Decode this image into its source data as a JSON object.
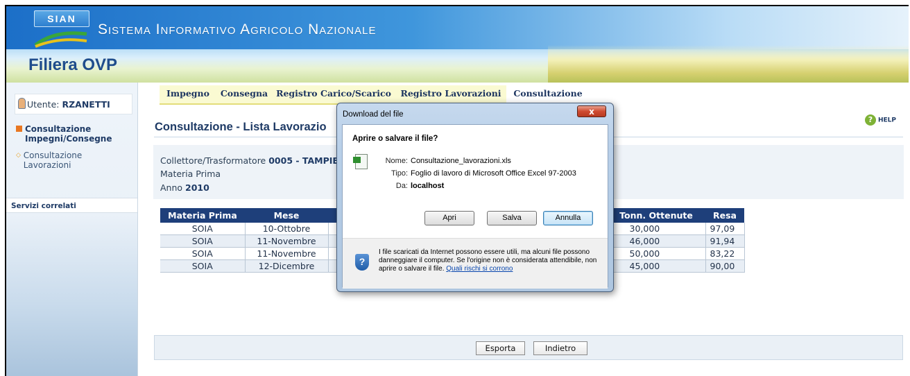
{
  "header": {
    "logo_text": "SIAN",
    "system_name": "Sistema Informativo Agricolo Nazionale",
    "app_name": "Filiera OVP"
  },
  "sidebar": {
    "user_label": "Utente:",
    "user_name": "RZANETTI",
    "items": [
      {
        "label": "Consultazione Impegni/Consegne"
      },
      {
        "label": "Consultazione Lavorazioni"
      }
    ],
    "related_label": "Servizi correlati"
  },
  "tabs": [
    {
      "label": "Impegno"
    },
    {
      "label": "Consegna"
    },
    {
      "label": "Registro Carico/Scarico"
    },
    {
      "label": "Registro Lavorazioni"
    },
    {
      "label": "Consultazione"
    }
  ],
  "help_label": "HELP",
  "page_title": "Consultazione - Lista Lavorazio",
  "info": {
    "collettore_label": "Collettore/Trasformatore",
    "collettore_value": "0005 - TAMPIE",
    "materia_label": "Materia Prima",
    "anno_label": "Anno",
    "anno_value": "2010"
  },
  "table": {
    "headers": {
      "materia": "Materia Prima",
      "mese": "Mese",
      "tonn": "Tonn. Ottenute",
      "resa": "Resa"
    },
    "rows": [
      {
        "materia": "SOIA",
        "mese": "10-Ottobre",
        "tonn": "30,000",
        "resa": "97,09"
      },
      {
        "materia": "SOIA",
        "mese": "11-Novembre",
        "tonn": "46,000",
        "resa": "91,94"
      },
      {
        "materia": "SOIA",
        "mese": "11-Novembre",
        "tonn": "50,000",
        "resa": "83,22"
      },
      {
        "materia": "SOIA",
        "mese": "12-Dicembre",
        "tonn": "45,000",
        "resa": "90,00"
      }
    ]
  },
  "buttons": {
    "esporta": "Esporta",
    "indietro": "Indietro"
  },
  "dialog": {
    "title": "Download del file",
    "close_label": "x",
    "question": "Aprire o salvare il file?",
    "nome_label": "Nome:",
    "nome_value": "Consultazione_lavorazioni.xls",
    "tipo_label": "Tipo:",
    "tipo_value": "Foglio di lavoro di Microsoft Office Excel 97-2003",
    "da_label": "Da:",
    "da_value": "localhost",
    "apri_label": "Apri",
    "salva_label": "Salva",
    "annulla_label": "Annulla",
    "warning_text": "I file scaricati da Internet possono essere utili, ma alcuni file possono danneggiare il computer. Se l'origine non è considerata attendibile, non aprire o salvare il file.",
    "warning_link": "Quali rischi si corrono"
  }
}
